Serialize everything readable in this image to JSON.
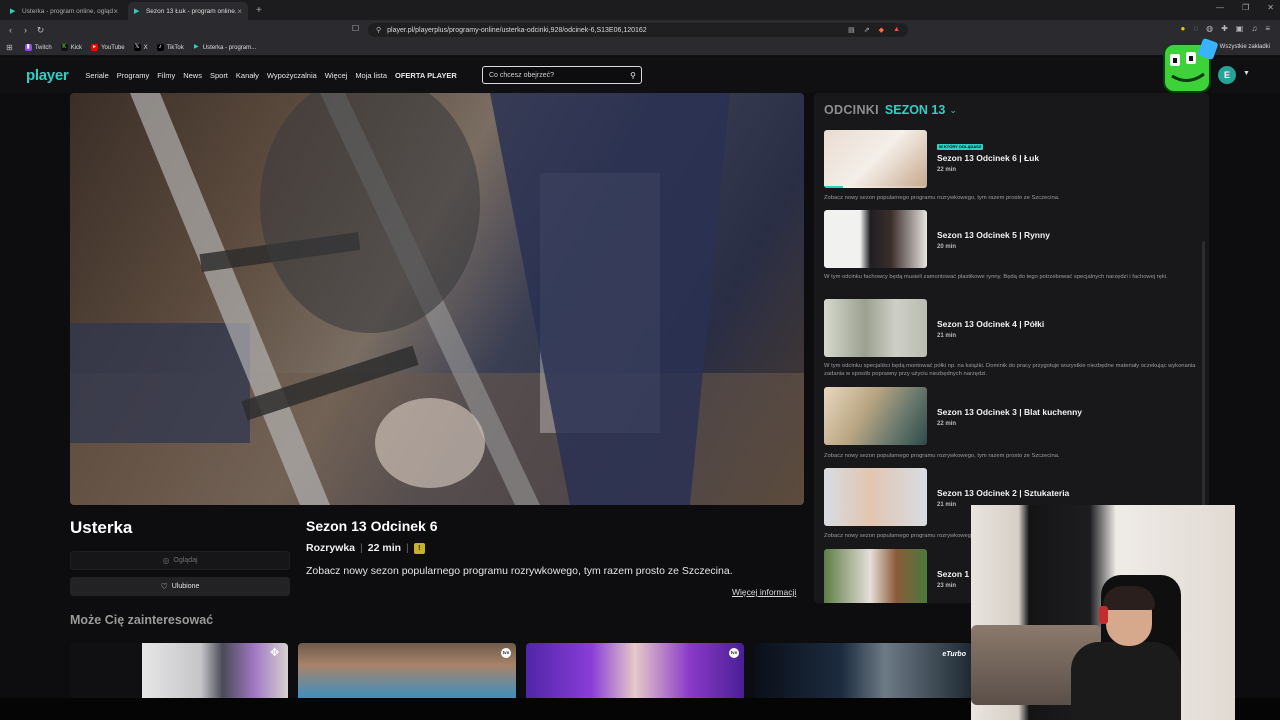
{
  "browser": {
    "tabs": [
      {
        "title": "Usterka - program online, oglądaj na...",
        "active": false
      },
      {
        "title": "Sezon 13 Łuk - program online...",
        "active": true
      }
    ],
    "url": "player.pl/playerplus/programy-online/usterka-odcinki,928/odcinek-6,S13E06,120162",
    "bookmarks": [
      "Twitch",
      "Kick",
      "YouTube",
      "X",
      "TikTok",
      "Usterka - program..."
    ],
    "all_bookmarks": "Wszystkie zakładki"
  },
  "site": {
    "logo": "player",
    "nav": [
      "Seriale",
      "Programy",
      "Filmy",
      "News",
      "Sport",
      "Kanały",
      "Wypożyczalnia",
      "Więcej",
      "Moja lista",
      "OFERTA PLAYER"
    ],
    "search_placeholder": "Co chcesz obejrzeć?",
    "avatar_letter": "E",
    "accent": "#2fd0c4"
  },
  "show": {
    "title": "Usterka",
    "watch_label": "Oglądaj",
    "favorite_label": "Ulubione"
  },
  "episode": {
    "title": "Sezon 13 Odcinek 6",
    "genre": "Rozrywka",
    "duration": "22 min",
    "age_rating": "!",
    "description": "Zobacz nowy sezon popularnego programu rozrywkowego, tym razem prosto ze Szczecina.",
    "more_info": "Więcej informacji"
  },
  "recommendations": {
    "title": "Może Cię zainteresować",
    "card_badges": [
      "",
      "tvn",
      "tvn",
      "eTurbo"
    ]
  },
  "episodes_panel": {
    "label": "ODCINKI",
    "season": "SEZON 13",
    "now_badge": "W KTÓRY OGLĄDASZ",
    "items": [
      {
        "title": "Sezon 13 Odcinek 6 | Łuk",
        "duration": "22 min",
        "description": "Zobacz nowy sezon popularnego programu rozrywkowego, tym razem prosto ze Szczecina.",
        "progress": 0.18,
        "current": true
      },
      {
        "title": "Sezon 13 Odcinek 5 | Rynny",
        "duration": "20 min",
        "description": "W tym odcinku fachowcy będą musieli zamontować plastikowe rynny. Będą do tego potrzebować specjalnych narzędzi i fachowej ręki.",
        "progress": 0,
        "current": false
      },
      {
        "title": "Sezon 13 Odcinek 4 | Półki",
        "duration": "21 min",
        "description": "W tym odcinku specjaliści będą montować półki np. na książki. Dominik do pracy przygotuje wszystkie niezbędne materiały oczekując wykonania zadania w sposób poprawny przy użyciu niezbędnych narzędzi.",
        "progress": 0,
        "current": false
      },
      {
        "title": "Sezon 13 Odcinek 3 | Blat kuchenny",
        "duration": "22 min",
        "description": "Zobacz nowy sezon popularnego programu rozrywkowego, tym razem prosto ze Szczecina.",
        "progress": 0,
        "current": false
      },
      {
        "title": "Sezon 13 Odcinek 2 | Sztukateria",
        "duration": "21 min",
        "description": "Zobacz nowy sezon popularnego programu rozrywkowego, tym razem prosto ze Szczecina.",
        "progress": 0,
        "current": false
      },
      {
        "title": "Sezon 1",
        "duration": "23 min",
        "description": "",
        "progress": 0,
        "current": false
      }
    ]
  }
}
